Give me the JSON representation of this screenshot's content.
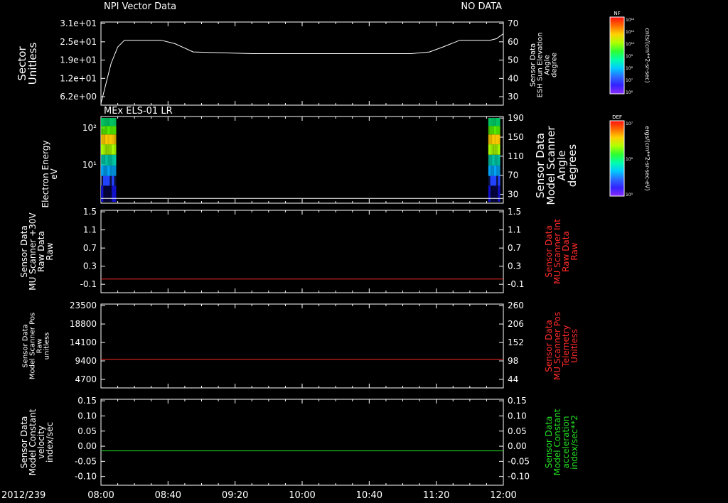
{
  "colors": {
    "background": "#000000",
    "axis": "#ffffff",
    "red_trace": "#ff2a2a",
    "green_trace": "#22dd22"
  },
  "time_axis": {
    "date_label": "2012/239",
    "ticks": [
      "08:00",
      "08:40",
      "09:20",
      "10:00",
      "10:40",
      "11:20",
      "12:00"
    ],
    "start": "08:00",
    "end": "12:00"
  },
  "chart_data": [
    {
      "type": "line",
      "title": "NPI Vector Data",
      "status": "NO DATA",
      "left_axis_labels": [
        "Sector",
        "Unitless"
      ],
      "left_ticks": [
        "3.1e+01",
        "2.5e+01",
        "1.9e+01",
        "1.2e+01",
        "6.2e+00"
      ],
      "right_axis_labels": [
        "Sensor Data",
        "ESH Sun Elevation",
        "Angle",
        "degree"
      ],
      "right_ticks": [
        "70",
        "60",
        "50",
        "40",
        "30"
      ],
      "ylim_right": [
        20,
        70
      ],
      "series": [
        {
          "x": [
            "08:00",
            "08:06",
            "08:10",
            "08:14",
            "08:25",
            "08:36",
            "08:44",
            "08:55",
            "09:30",
            "10:00",
            "10:30",
            "11:05",
            "11:16",
            "11:24",
            "11:34",
            "11:44",
            "11:52",
            "11:56",
            "12:00"
          ],
          "y": [
            21,
            45,
            55,
            59,
            59,
            59,
            57,
            52,
            51,
            51,
            51,
            51,
            52,
            55,
            59,
            59,
            59,
            60,
            63
          ]
        }
      ],
      "colorbar": {
        "label": "NF",
        "unit": "cnts/(cm**2-sr-sec)",
        "ticks": [
          "10¹²",
          "10¹¹",
          "10¹⁰",
          "10⁹",
          "10⁸",
          "10⁷",
          "10⁶"
        ]
      }
    },
    {
      "type": "heatmap",
      "title": "MEx ELS-01 LR",
      "left_axis_labels": [
        "Electron Energy",
        "eV"
      ],
      "left_ticks": [
        "10²",
        "10¹"
      ],
      "right_axis_labels": [
        "Sensor Data",
        "Model Scanner",
        "Angle",
        "degrees"
      ],
      "right_ticks": [
        "190",
        "150",
        "110",
        "70",
        "30"
      ],
      "data_blocks": [
        {
          "x_start": "08:00",
          "x_end": "08:09"
        },
        {
          "x_start": "11:51",
          "x_end": "11:58"
        }
      ],
      "energy_levels": [
        {
          "value": 180,
          "color": "#00cc66"
        },
        {
          "value": 120,
          "color": "#55ee00"
        },
        {
          "value": 70,
          "color": "#ffcc00"
        },
        {
          "value": 40,
          "color": "#aaff00"
        },
        {
          "value": 22,
          "color": "#00ccaa"
        },
        {
          "value": 12,
          "color": "#00aaff"
        },
        {
          "value": 7,
          "color": "#2244ff"
        },
        {
          "value": 4,
          "color": "#1111cc"
        }
      ],
      "right_series": [
        {
          "x": [
            "08:00",
            "12:00"
          ],
          "y": [
            20,
            20
          ]
        }
      ],
      "colorbar": {
        "label": "DEF",
        "unit": "ergs/(cm**2-sr-sec-eV)",
        "ticks": [
          "10⁷",
          "10⁶",
          "10⁵"
        ]
      }
    },
    {
      "type": "line",
      "left_axis_labels": [
        "Sensor Data",
        "MU Scanner +30V",
        "Raw Data",
        "Raw"
      ],
      "left_ticks": [
        "1.5",
        "1.1",
        "0.7",
        "0.3",
        "-0.1"
      ],
      "right_axis_labels": [
        "Sensor Data",
        "MU Scanner Int",
        "Raw Data",
        "Raw"
      ],
      "right_ticks": [
        "1.5",
        "1.1",
        "0.7",
        "0.3",
        "-0.1"
      ],
      "ylim": [
        -0.3,
        1.5
      ],
      "series": [
        {
          "x": [
            "08:00",
            "12:00"
          ],
          "y": [
            0,
            0
          ]
        }
      ]
    },
    {
      "type": "line",
      "left_axis_labels": [
        "Sensor Data",
        "Model Scanner Pos",
        "Raw",
        "unitless"
      ],
      "left_ticks": [
        "23500",
        "18800",
        "14100",
        "9400",
        "4700"
      ],
      "right_axis_labels": [
        "Sensor Data",
        "MU Scanner Pos",
        "Telemetry",
        "Unitless"
      ],
      "right_ticks": [
        "260",
        "206",
        "152",
        "98",
        "44"
      ],
      "ylim": [
        0,
        23500
      ],
      "series": [
        {
          "x": [
            "08:00",
            "12:00"
          ],
          "y": [
            8000,
            8000
          ]
        }
      ]
    },
    {
      "type": "line",
      "left_axis_labels": [
        "Sensor Data",
        "Model Constant",
        "velocity",
        "index/sec"
      ],
      "left_ticks": [
        "0.15",
        "0.10",
        "0.05",
        "0.00",
        "-0.05",
        "-0.10"
      ],
      "right_axis_labels": [
        "Sensor Data",
        "Model Constant",
        "acceleration",
        "index/sec**2"
      ],
      "right_ticks": [
        "0.15",
        "0.10",
        "0.05",
        "0.00",
        "-0.05",
        "-0.10"
      ],
      "ylim": [
        -0.1,
        0.15
      ],
      "series": [
        {
          "x": [
            "08:00",
            "12:00"
          ],
          "y": [
            0,
            0
          ]
        }
      ]
    }
  ]
}
